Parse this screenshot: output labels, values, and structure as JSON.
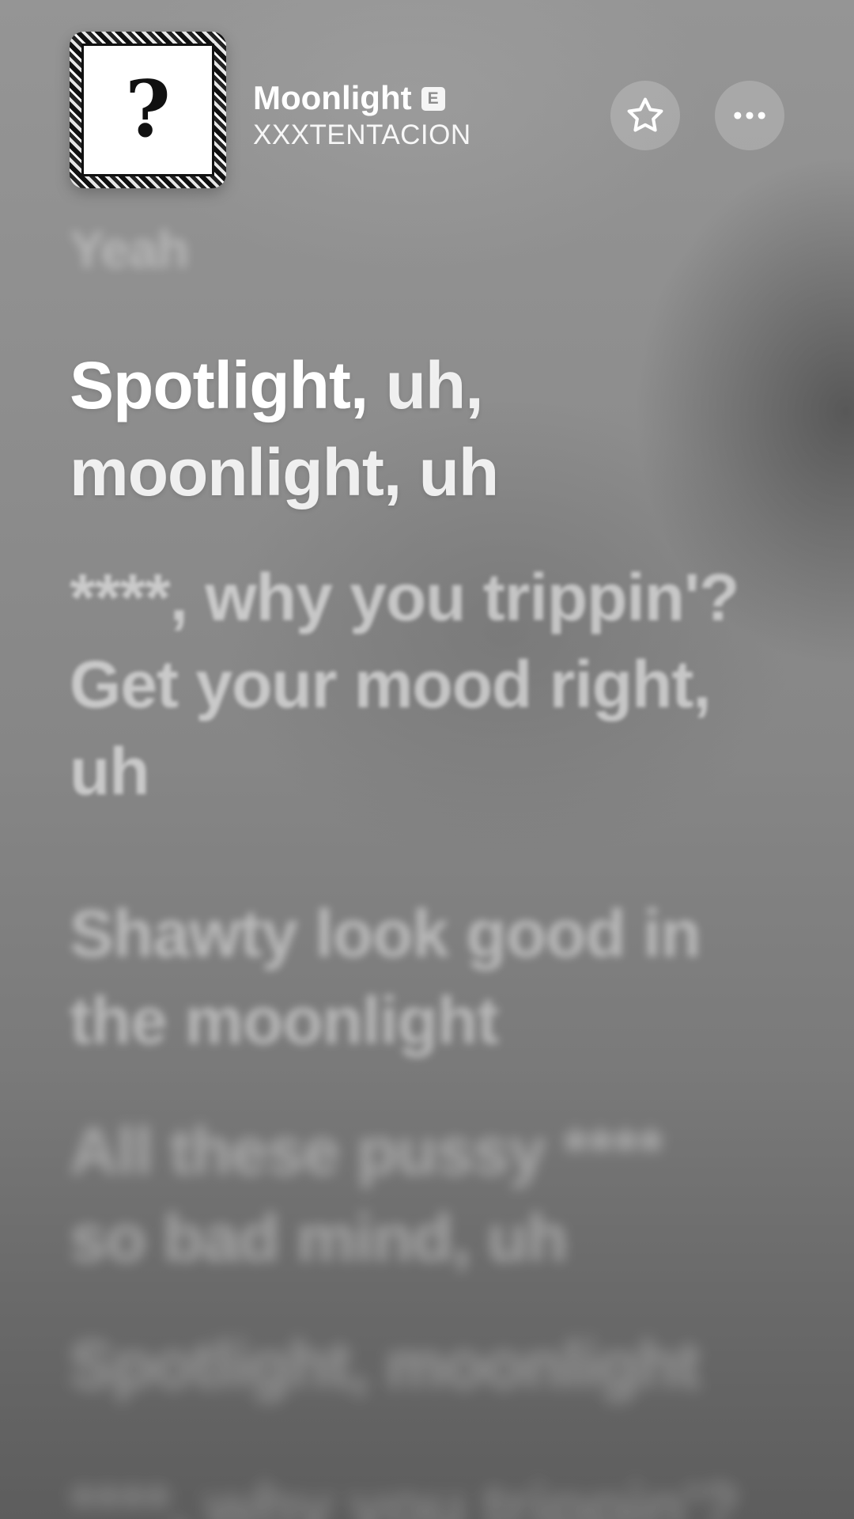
{
  "now_playing": {
    "title": "Moonlight",
    "explicit_badge": "E",
    "artist": "XXXTENTACION",
    "artwork_glyph": "?"
  },
  "actions": {
    "favorite_icon": "star-outline-icon",
    "more_icon": "ellipsis-icon"
  },
  "lyrics": {
    "previous": "Yeah",
    "current_highlighted": "Spotlight,",
    "current_rest": " uh,\nmoonlight, uh",
    "upcoming": [
      "****, why you trippin'?\nGet your mood right,\nuh",
      "Shawty look good in\nthe moonlight",
      "All these pussy ****\nso bad mind, uh",
      "Spotlight, moonlight",
      "****, why you trippin'?"
    ]
  },
  "colors": {
    "background": "#8c8c8c",
    "text": "#ffffff"
  }
}
